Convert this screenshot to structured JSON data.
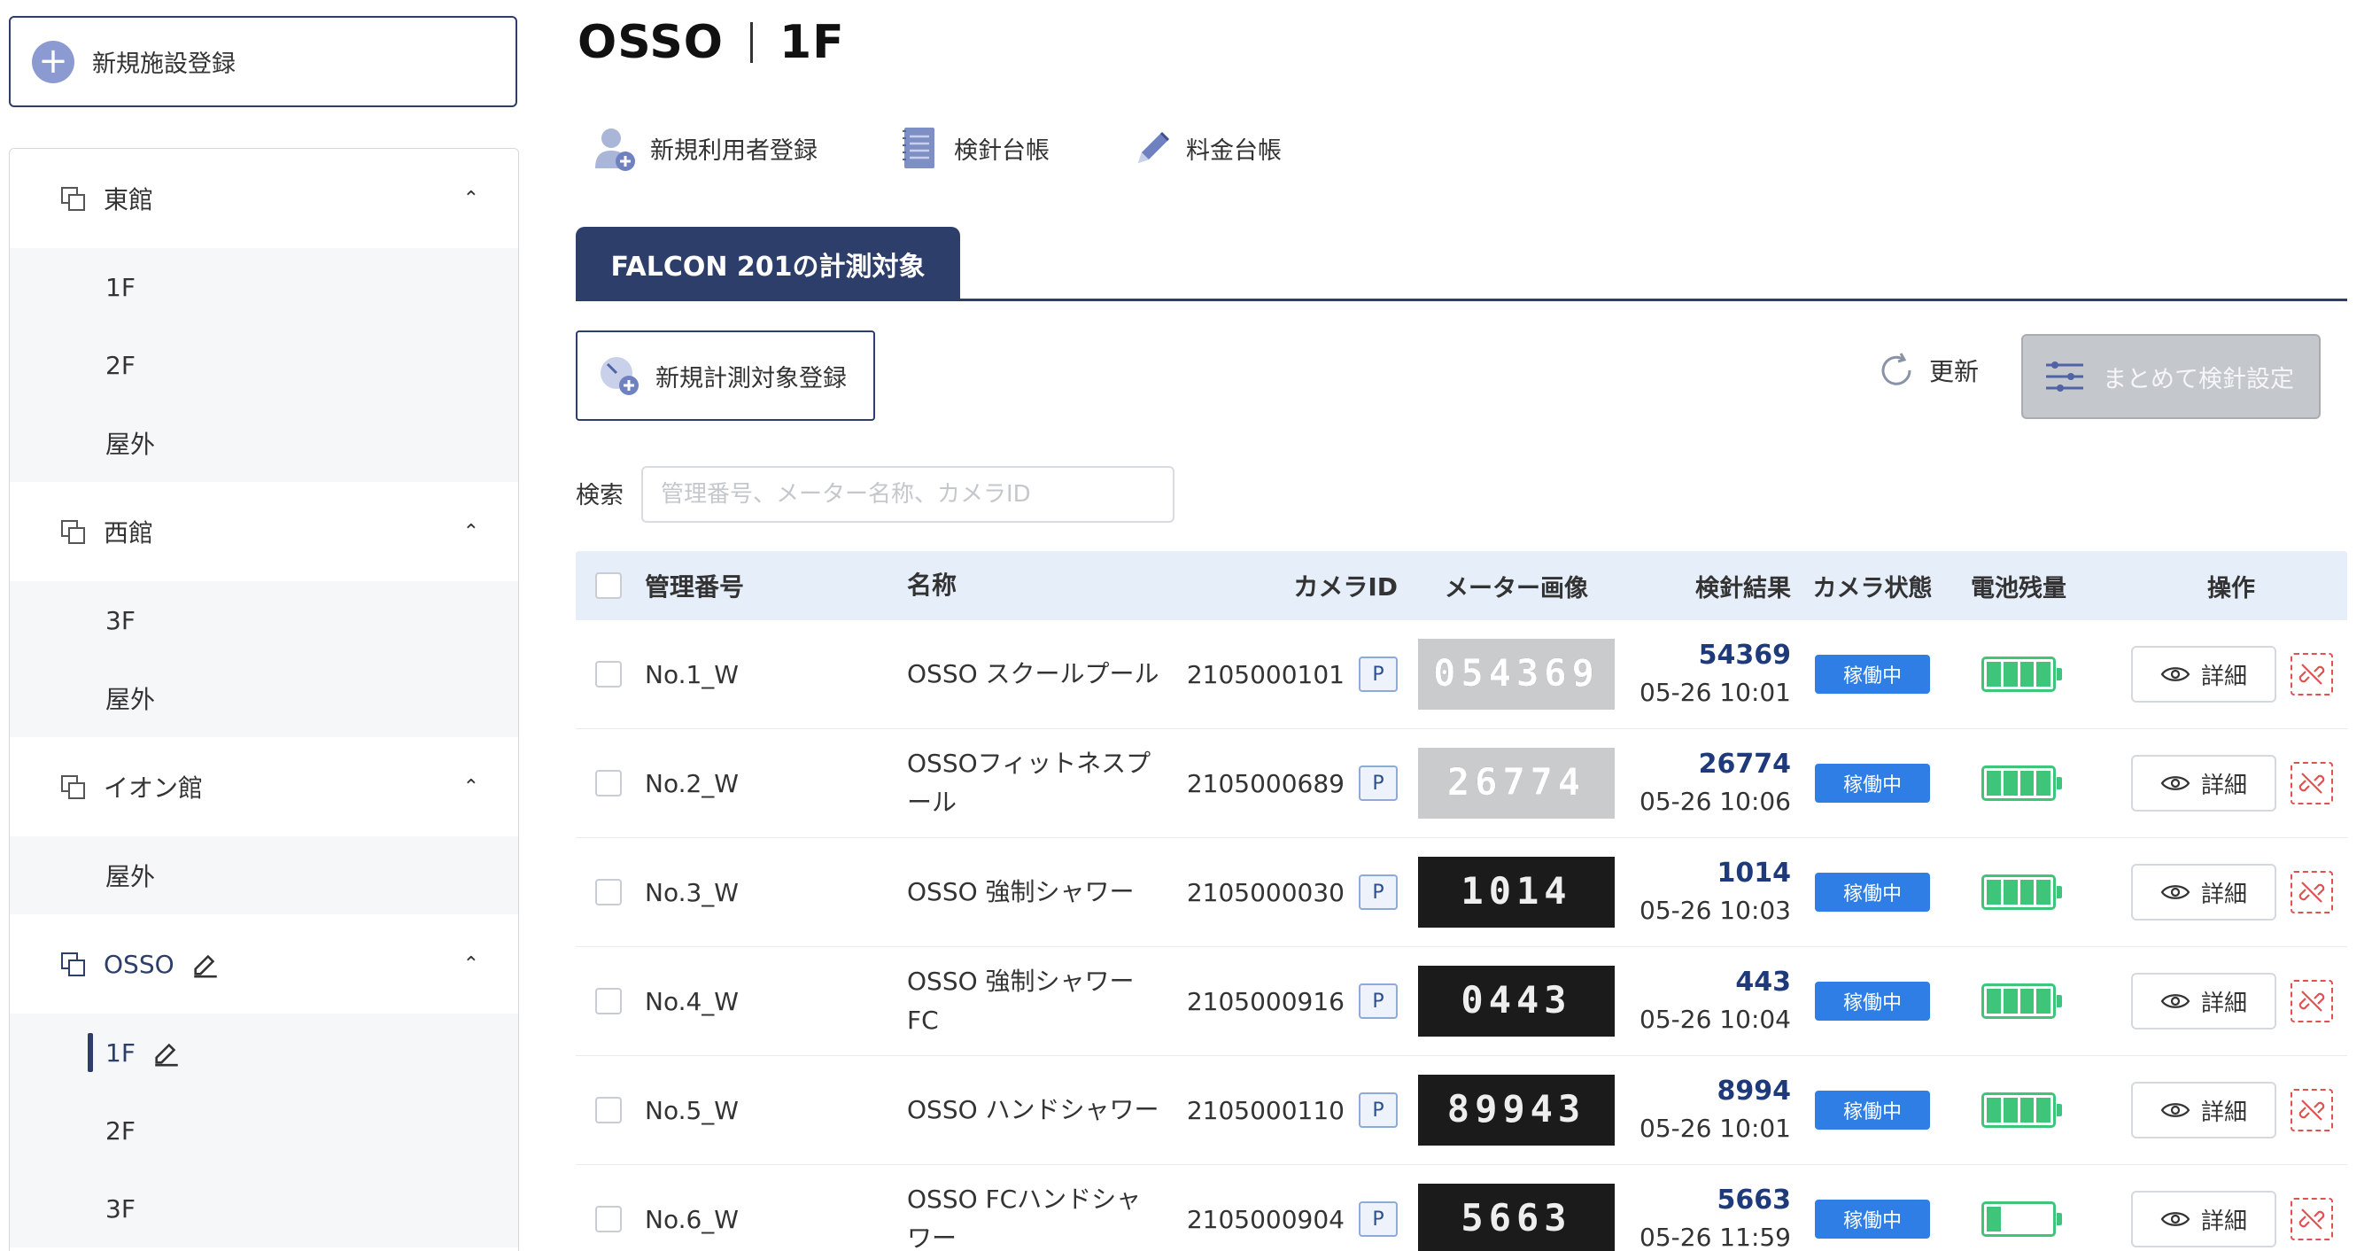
{
  "sidebar": {
    "new_facility_label": "新規施設登録",
    "groups": [
      {
        "name": "東館",
        "children": [
          "1F",
          "2F",
          "屋外"
        ]
      },
      {
        "name": "西館",
        "children": [
          "3F",
          "屋外"
        ]
      },
      {
        "name": "イオン館",
        "children": [
          "屋外"
        ]
      },
      {
        "name": "OSSO",
        "children": [
          "1F",
          "2F",
          "3F"
        ]
      }
    ],
    "active_group": "OSSO",
    "active_child": "1F"
  },
  "header": {
    "facility": "OSSO",
    "floor": "1F",
    "actions": [
      {
        "label": "新規利用者登録",
        "icon": "user-add-icon"
      },
      {
        "label": "検針台帳",
        "icon": "ledger-icon"
      },
      {
        "label": "料金台帳",
        "icon": "pencil-icon"
      }
    ]
  },
  "tab": {
    "label": "FALCON 201の計測対象"
  },
  "toolbar": {
    "new_target_label": "新規計測対象登録",
    "refresh_label": "更新",
    "bulk_label": "まとめて検針設定"
  },
  "search": {
    "label": "検索",
    "placeholder": "管理番号、メーター名称、カメラID",
    "value": ""
  },
  "table": {
    "columns": [
      "管理番号",
      "名称",
      "カメラID",
      "メーター画像",
      "検針結果",
      "カメラ状態",
      "電池残量",
      "操作"
    ],
    "p_badge": "P",
    "detail_label": "詳細",
    "rows": [
      {
        "id": "No.1_W",
        "name": "OSSO スクールプール",
        "camera_id": "2105000101",
        "meter_digits": "054369",
        "result": "54369",
        "timestamp": "05-26 10:01",
        "status": "稼働中",
        "battery_level": 1.0
      },
      {
        "id": "No.2_W",
        "name": "OSSOフィットネスプール",
        "camera_id": "2105000689",
        "meter_digits": "26774",
        "result": "26774",
        "timestamp": "05-26 10:06",
        "status": "稼働中",
        "battery_level": 1.0
      },
      {
        "id": "No.3_W",
        "name": "OSSO 強制シャワー",
        "camera_id": "2105000030",
        "meter_digits": "1014",
        "result": "1014",
        "timestamp": "05-26 10:03",
        "status": "稼働中",
        "battery_level": 1.0
      },
      {
        "id": "No.4_W",
        "name": "OSSO 強制シャワーFC",
        "camera_id": "2105000916",
        "meter_digits": "0443",
        "result": "443",
        "timestamp": "05-26 10:04",
        "status": "稼働中",
        "battery_level": 1.0
      },
      {
        "id": "No.5_W",
        "name": "OSSO ハンドシャワー",
        "camera_id": "2105000110",
        "meter_digits": "89943",
        "result": "8994",
        "timestamp": "05-26 10:01",
        "status": "稼働中",
        "battery_level": 1.0
      },
      {
        "id": "No.6_W",
        "name": "OSSO FCハンドシャワー",
        "camera_id": "2105000904",
        "meter_digits": "5663",
        "result": "5663",
        "timestamp": "05-26 11:59",
        "status": "稼働中",
        "battery_level": 0.25
      }
    ]
  },
  "colors": {
    "primary": "#2d3e6b",
    "status_blue": "#2f7ee6",
    "battery_green": "#3ec57a",
    "result_blue": "#1f3a7a",
    "danger": "#e05252"
  }
}
